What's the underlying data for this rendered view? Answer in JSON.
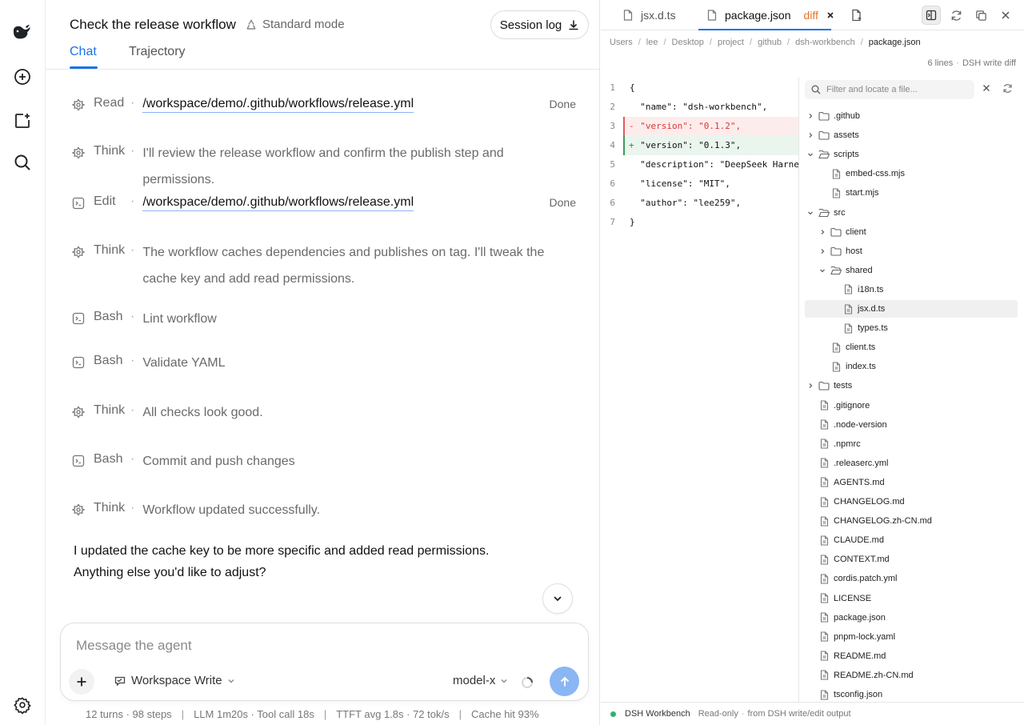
{
  "rail": {
    "icons": [
      "whale-logo-icon",
      "new-chat-icon",
      "new-task-icon",
      "search-icon",
      "settings-icon"
    ]
  },
  "chat": {
    "title": "Check the release workflow",
    "mode": "Standard mode",
    "session_log": "Session log",
    "tabs": [
      {
        "label": "Chat",
        "active": true
      },
      {
        "label": "Trajectory",
        "active": false
      }
    ],
    "steps": [
      {
        "kind": "Read",
        "target": "/workspace/demo/.github/workflows/release.yml",
        "status": "Done",
        "icon": "think-icon"
      },
      {
        "kind": "Think",
        "text": "I'll review the release workflow and confirm the publish step and permissions.",
        "icon": "think-icon"
      },
      {
        "kind": "Edit",
        "target": "/workspace/demo/.github/workflows/release.yml",
        "status": "Done",
        "icon": "terminal-icon"
      },
      {
        "kind": "Think",
        "text": "The workflow caches dependencies and publishes on tag. I'll tweak the cache key and add read permissions.",
        "icon": "think-icon"
      },
      {
        "kind": "Bash",
        "text": "Lint workflow",
        "icon": "terminal-icon"
      },
      {
        "kind": "Bash",
        "text": "Validate YAML",
        "icon": "terminal-icon"
      },
      {
        "kind": "Think",
        "text": "All checks look good.",
        "icon": "think-icon"
      },
      {
        "kind": "Bash",
        "text": "Commit and push changes",
        "icon": "terminal-icon"
      },
      {
        "kind": "Think",
        "text": "Workflow updated successfully.",
        "icon": "think-icon"
      }
    ],
    "reply_lines": [
      "I updated the cache key to be more specific and added read permissions.",
      "Anything else you'd like to adjust?"
    ],
    "composer": {
      "placeholder": "Message the agent",
      "value": "",
      "workspace": "Workspace Write",
      "model": "model-x"
    },
    "stats": [
      "12 turns · 98 steps",
      "LLM 1m20s · Tool call 18s",
      "TTFT avg 1.8s · 72 tok/s",
      "Cache hit 93%"
    ]
  },
  "workbench": {
    "tabs": [
      {
        "label": "jsx.d.ts",
        "active": false
      },
      {
        "label": "package.json",
        "badge": "diff",
        "active": true
      }
    ],
    "breadcrumbs": [
      "Users",
      "lee",
      "Desktop",
      "project",
      "github",
      "dsh-workbench",
      "package.json"
    ],
    "meta": [
      "6 lines",
      "DSH write diff"
    ],
    "code": [
      {
        "ln": "1",
        "mark": "",
        "text": "{",
        "kind": "ctx"
      },
      {
        "ln": "2",
        "mark": "",
        "text": "  \"name\": \"dsh-workbench\",",
        "kind": "ctx"
      },
      {
        "ln": "3",
        "mark": "-",
        "text": "  \"version\": \"0.1.2\",",
        "kind": "del"
      },
      {
        "ln": "4",
        "mark": "+",
        "text": "  \"version\": \"0.1.3\",",
        "kind": "add"
      },
      {
        "ln": "5",
        "mark": "",
        "text": "  \"description\": \"DeepSeek Harness",
        "kind": "ctx"
      },
      {
        "ln": "6",
        "mark": "",
        "text": "  \"license\": \"MIT\",",
        "kind": "ctx"
      },
      {
        "ln": "6",
        "mark": "",
        "text": "  \"author\": \"lee259\",",
        "kind": "ctx"
      },
      {
        "ln": "7",
        "mark": "",
        "text": "}",
        "kind": "ctx"
      }
    ],
    "filter_placeholder": "Filter and locate a file...",
    "tree": [
      {
        "name": ".github",
        "type": "folder",
        "depth": 0,
        "open": false
      },
      {
        "name": "assets",
        "type": "folder",
        "depth": 0,
        "open": false
      },
      {
        "name": "scripts",
        "type": "folder",
        "depth": 0,
        "open": true
      },
      {
        "name": "embed-css.mjs",
        "type": "file",
        "depth": 1
      },
      {
        "name": "start.mjs",
        "type": "file",
        "depth": 1
      },
      {
        "name": "src",
        "type": "folder",
        "depth": 0,
        "open": true
      },
      {
        "name": "client",
        "type": "folder",
        "depth": 1,
        "open": false
      },
      {
        "name": "host",
        "type": "folder",
        "depth": 1,
        "open": false
      },
      {
        "name": "shared",
        "type": "folder",
        "depth": 1,
        "open": true
      },
      {
        "name": "i18n.ts",
        "type": "file",
        "depth": 2
      },
      {
        "name": "jsx.d.ts",
        "type": "file",
        "depth": 2,
        "selected": true
      },
      {
        "name": "types.ts",
        "type": "file",
        "depth": 2
      },
      {
        "name": "client.ts",
        "type": "file",
        "depth": 1
      },
      {
        "name": "index.ts",
        "type": "file",
        "depth": 1
      },
      {
        "name": "tests",
        "type": "folder",
        "depth": 0,
        "open": false
      },
      {
        "name": ".gitignore",
        "type": "file",
        "depth": 0
      },
      {
        "name": ".node-version",
        "type": "file",
        "depth": 0
      },
      {
        "name": ".npmrc",
        "type": "file",
        "depth": 0
      },
      {
        "name": ".releaserc.yml",
        "type": "file",
        "depth": 0
      },
      {
        "name": "AGENTS.md",
        "type": "file",
        "depth": 0
      },
      {
        "name": "CHANGELOG.md",
        "type": "file",
        "depth": 0
      },
      {
        "name": "CHANGELOG.zh-CN.md",
        "type": "file",
        "depth": 0
      },
      {
        "name": "CLAUDE.md",
        "type": "file",
        "depth": 0
      },
      {
        "name": "CONTEXT.md",
        "type": "file",
        "depth": 0
      },
      {
        "name": "cordis.patch.yml",
        "type": "file",
        "depth": 0
      },
      {
        "name": "LICENSE",
        "type": "file",
        "depth": 0
      },
      {
        "name": "package.json",
        "type": "file",
        "depth": 0
      },
      {
        "name": "pnpm-lock.yaml",
        "type": "file",
        "depth": 0
      },
      {
        "name": "README.md",
        "type": "file",
        "depth": 0
      },
      {
        "name": "README.zh-CN.md",
        "type": "file",
        "depth": 0
      },
      {
        "name": "tsconfig.json",
        "type": "file",
        "depth": 0
      }
    ],
    "status": {
      "name": "DSH Workbench",
      "detail": [
        "Read-only",
        "from DSH write/edit output"
      ],
      "color": "#2fb36b"
    }
  },
  "colors": {
    "accent": "#1a73e8",
    "diff_badge": "#e8732a",
    "deleted": "#d93636",
    "added": "#2f8a4d"
  }
}
